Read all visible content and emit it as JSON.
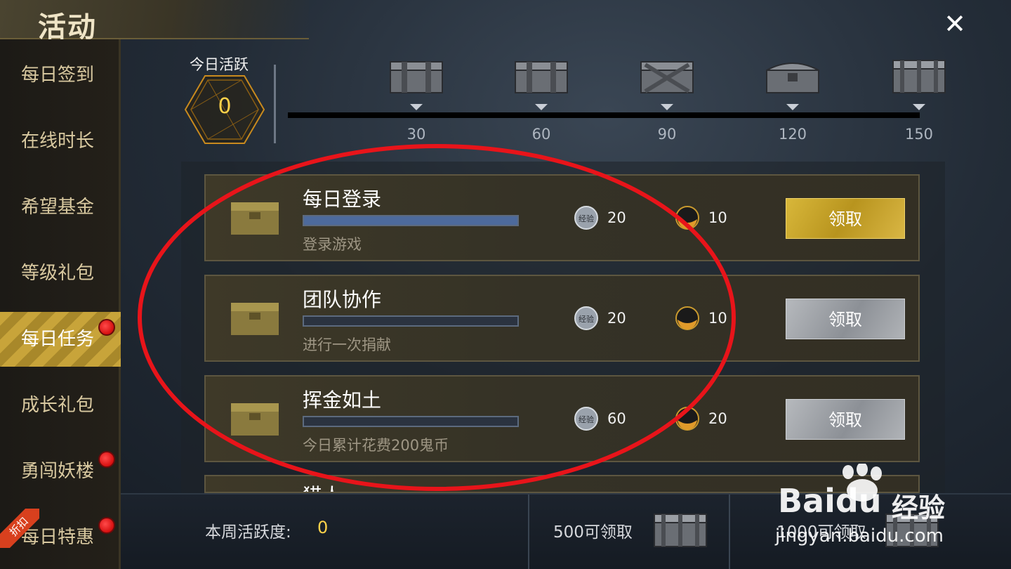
{
  "header": {
    "title": "活动",
    "close_icon": "close-icon"
  },
  "sidebar": {
    "items": [
      {
        "label": "每日签到",
        "active": false,
        "red_dot": false
      },
      {
        "label": "在线时长",
        "active": false,
        "red_dot": false
      },
      {
        "label": "希望基金",
        "active": false,
        "red_dot": false
      },
      {
        "label": "等级礼包",
        "active": false,
        "red_dot": false
      },
      {
        "label": "每日任务",
        "active": true,
        "red_dot": true
      },
      {
        "label": "成长礼包",
        "active": false,
        "red_dot": false
      },
      {
        "label": "勇闯妖楼",
        "active": false,
        "red_dot": true
      },
      {
        "label": "每日特惠",
        "active": false,
        "red_dot": true
      }
    ],
    "discount_tag": "折扣"
  },
  "activity": {
    "label": "今日活跃",
    "value": "0",
    "milestones": [
      "30",
      "60",
      "90",
      "120",
      "150"
    ]
  },
  "tasks": [
    {
      "title": "每日登录",
      "desc": "登录游戏",
      "exp": "20",
      "coin": "10",
      "claim": "领取",
      "claim_state": "gold"
    },
    {
      "title": "团队协作",
      "desc": "进行一次捐献",
      "exp": "20",
      "coin": "10",
      "claim": "领取",
      "claim_state": "gray"
    },
    {
      "title": "挥金如土",
      "desc": "今日累计花费200鬼币",
      "exp": "60",
      "coin": "20",
      "claim": "领取",
      "claim_state": "gray"
    }
  ],
  "partial_task": {
    "title": "猎人"
  },
  "reward_icons": {
    "exp_badge": "经验",
    "exp_icon": "exp-coin-icon",
    "coin_icon": "gold-orb-icon"
  },
  "bottom": {
    "weekly_label": "本周活跃度:",
    "weekly_value": "0",
    "reward_500": "500可领取",
    "reward_1000": "1000可领取"
  },
  "watermark": {
    "brand": "Baidu",
    "brand_cn": "经验",
    "url": "jingyan.baidu.com"
  },
  "colors": {
    "accent_gold": "#c8a43a",
    "value_yellow": "#ffd24a",
    "annotation_red": "#e8141a"
  }
}
